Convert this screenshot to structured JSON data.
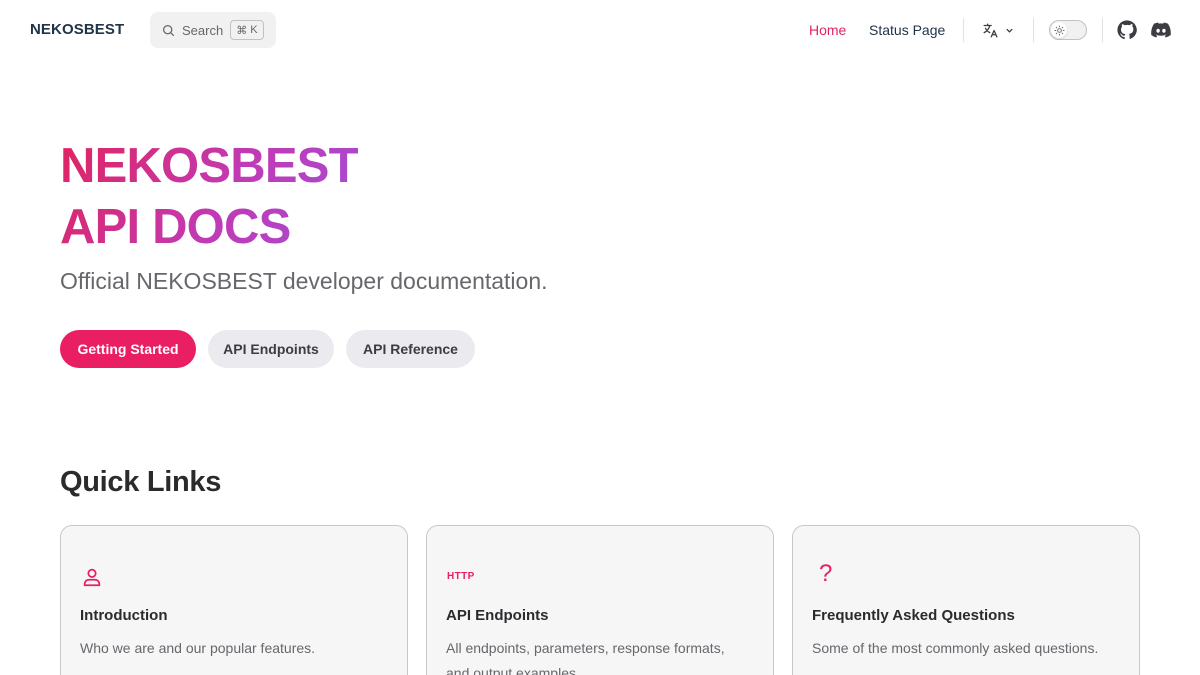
{
  "nav": {
    "brand": "NEKOSBEST",
    "search_label": "Search",
    "search_kbd_mod": "⌘",
    "search_kbd_key": "K",
    "links": [
      {
        "label": "Home",
        "active": true
      },
      {
        "label": "Status Page",
        "active": false
      }
    ],
    "icons": {
      "translate": "translate-icon",
      "theme": "sun-icon",
      "github": "github-icon",
      "discord": "discord-icon"
    }
  },
  "hero": {
    "title_line1": "NEKOSBEST",
    "title_line2": "API DOCS",
    "tagline": "Official NEKOSBEST developer documentation.",
    "actions": [
      {
        "label": "Getting Started",
        "theme": "brand"
      },
      {
        "label": "API Endpoints",
        "theme": "alt"
      },
      {
        "label": "API Reference",
        "theme": "alt"
      }
    ]
  },
  "quick_links": {
    "title": "Quick Links",
    "cards": [
      {
        "icon": "user-icon",
        "title": "Introduction",
        "desc": "Who we are and our popular features."
      },
      {
        "icon": "http-icon",
        "icon_text": "HTTP",
        "title": "API Endpoints",
        "desc": "All endpoints, parameters, response formats, and output examples."
      },
      {
        "icon": "question-icon",
        "icon_text": "?",
        "title": "Frequently Asked Questions",
        "desc": "Some of the most commonly asked questions."
      }
    ]
  },
  "colors": {
    "brand": "#e91e63",
    "active_link": "#e0245e",
    "gradient_start": "#e0245e",
    "gradient_end": "#a24ed8"
  }
}
